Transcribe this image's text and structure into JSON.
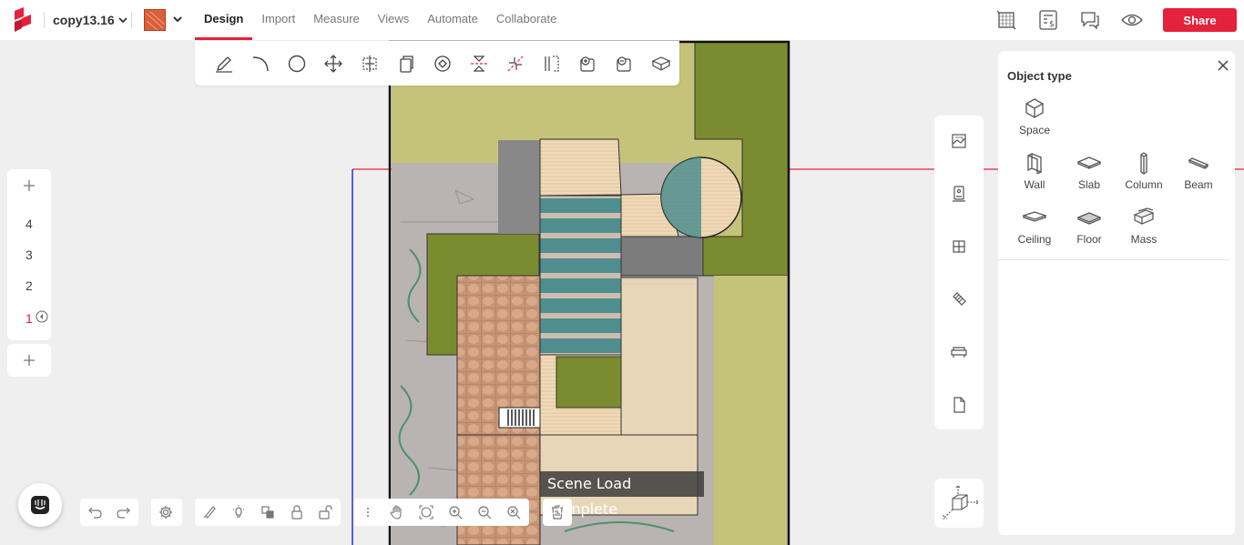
{
  "app": {
    "project_name": "copy13.16",
    "nav_tabs": [
      "Design",
      "Import",
      "Measure",
      "Views",
      "Automate",
      "Collaborate"
    ],
    "active_tab": "Design",
    "share_label": "Share",
    "brand_color": "#e5213b"
  },
  "top_icons": [
    "sheet-grid-icon",
    "estimate-icon",
    "comment-icon",
    "eye-icon"
  ],
  "design_tools": [
    "pencil-icon",
    "arc-icon",
    "circle-icon",
    "move-icon",
    "select-move-icon",
    "copy-icon",
    "rotate-icon",
    "mirror-icon",
    "split-icon",
    "offset-icon",
    "add-shape-icon",
    "subtract-shape-icon",
    "extrude-icon"
  ],
  "levels": {
    "items": [
      "4",
      "3",
      "2",
      "1"
    ],
    "active": "1"
  },
  "right_tools": [
    "image-icon",
    "elevator-icon",
    "window-icon",
    "door-icon",
    "furniture-icon",
    "document-icon"
  ],
  "object_panel": {
    "title": "Object type",
    "items": [
      {
        "label": "Space",
        "icon": "cube-icon"
      },
      {
        "label": "Wall",
        "icon": "wall-icon"
      },
      {
        "label": "Slab",
        "icon": "slab-icon"
      },
      {
        "label": "Column",
        "icon": "column-icon"
      },
      {
        "label": "Beam",
        "icon": "beam-icon"
      },
      {
        "label": "Ceiling",
        "icon": "ceiling-icon"
      },
      {
        "label": "Floor",
        "icon": "floor-icon"
      },
      {
        "label": "Mass",
        "icon": "mass-icon"
      }
    ]
  },
  "bottom_tools": {
    "history": [
      "undo-icon",
      "redo-icon"
    ],
    "settings": [
      "settings-icon"
    ],
    "scene": [
      "paint-icon",
      "light-icon",
      "layers-icon",
      "lock-icon",
      "unlock-icon"
    ],
    "view": [
      "more-icon",
      "pan-icon",
      "zoom-extents-icon",
      "zoom-in-icon",
      "zoom-out-icon",
      "zoom-window-icon"
    ],
    "delete": [
      "trash-icon"
    ]
  },
  "toast": "Scene Load Complete"
}
